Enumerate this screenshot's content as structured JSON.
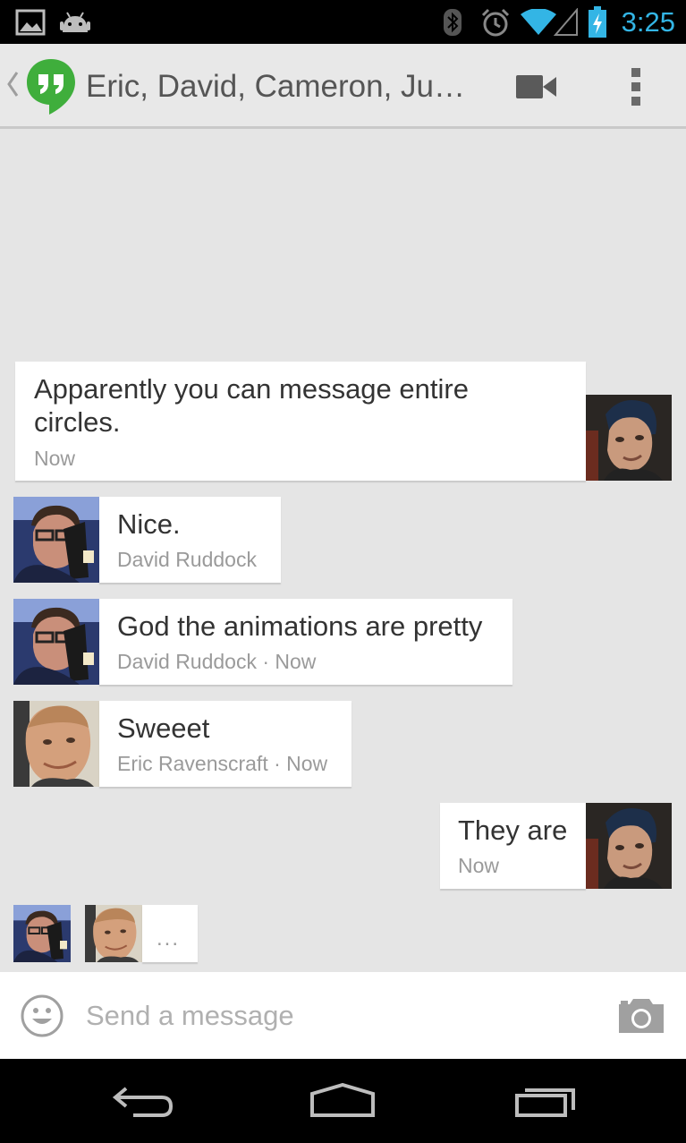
{
  "status_bar": {
    "time": "3:25",
    "icons": [
      "gallery-notification-icon",
      "android-notification-icon",
      "bluetooth-icon",
      "alarm-icon",
      "wifi-icon",
      "signal-icon",
      "battery-charging-icon"
    ]
  },
  "action_bar": {
    "title": "Eric, David, Cameron, Justin",
    "app_icon": "hangouts-icon",
    "actions": [
      "video-call-icon",
      "overflow-menu-icon"
    ]
  },
  "messages": [
    {
      "text_line1": "Apparently you can message entire",
      "text_line2": "circles.",
      "meta": "Now",
      "outgoing": true
    },
    {
      "text": "Nice.",
      "meta": "David Ruddock",
      "outgoing": false
    },
    {
      "text": "God the animations are pretty",
      "meta": "David Ruddock · Now",
      "outgoing": false
    },
    {
      "text": "Sweeet",
      "meta": "Eric Ravenscraft · Now",
      "outgoing": false
    },
    {
      "text": "They are",
      "meta": "Now",
      "outgoing": true
    }
  ],
  "typing_indicator": "...",
  "compose": {
    "placeholder": "Send a message",
    "emoji_icon": "emoji-icon",
    "camera_icon": "camera-icon"
  },
  "nav_bar": [
    "back-icon",
    "home-icon",
    "recent-apps-icon"
  ],
  "colors": {
    "accent_blue": "#33b5e5",
    "hangouts_green": "#3fae3c",
    "background": "#e5e5e5"
  }
}
